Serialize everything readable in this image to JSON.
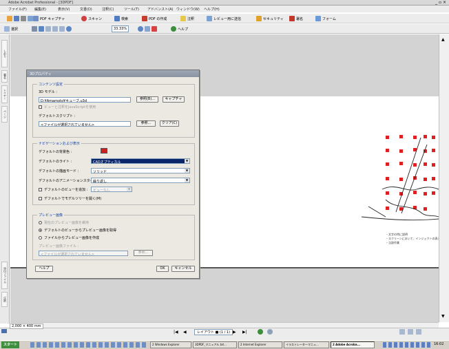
{
  "window": {
    "title": "Adobe Acrobat Professional - [3DPDF]",
    "min": "_",
    "restore": "▫",
    "close": "×"
  },
  "menu": [
    "ファイル(F)",
    "編集(E)",
    "表示(V)",
    "文書(D)",
    "注釈(C)",
    "ツール(T)",
    "アドバンスト(A)",
    "ウィンドウ(W)",
    "ヘルプ(H)"
  ],
  "toolbar1": {
    "create_pdf": "PDF キャプチャ",
    "scan": "スキャン",
    "search": "検索",
    "pdf_create": "PDF の作成",
    "comment": "注釈",
    "review": "レビュー用に送信",
    "security": "セキュリティ",
    "sign": "署名",
    "forms": "フォーム"
  },
  "toolbar2": {
    "select": "選択",
    "zoom": "33.33%",
    "help": "ヘルプ"
  },
  "leftbar_tabs": [
    "しおり",
    "署名",
    "レイヤー",
    "ページ",
    "添付ファイル",
    "注釈"
  ],
  "dialog": {
    "title": "3Dプロパティ",
    "content_group": "コンテンツ設定",
    "model_label": "3D モデル :",
    "model_value": "D:¥Amamoto¥キューブ.u3d",
    "browse_button": "参照(B)...",
    "cancel_small_button": "キャプチャ",
    "embed_check": "ビューと注釈をJavaScriptを使用",
    "script_label": "デフォルトスクリプト :",
    "script_value": "<ファイルが選択されていません>",
    "script_browse": "参照...",
    "clear_button": "クリア(C)",
    "nav_group": "ナビゲーションおよび表示",
    "bg_label": "デフォルトの背景色 :",
    "bg_color": "#cc1f1f",
    "light_label": "デフォルトのライト :",
    "light_value": "CADオプティカル",
    "render_label": "デフォルトの描画モード :",
    "render_value": "ソリッド",
    "anim_label": "デフォルトのアニメーションスタイル :",
    "anim_value": "繰り返し",
    "views_check": "デフォルトのビューを追加 :",
    "views_value": "ビューなし",
    "tree_check": "デフォルトでモデルツリーを開く(M)",
    "preview_group": "プレビュー画像",
    "preview_radio1": "現在のプレビュー画像を維持",
    "preview_radio2": "デフォルトのビューからプレビュー画像を取得",
    "preview_radio3": "ファイルからプレビュー画像を作成",
    "preview_file_label": "プレビュー画像ファイル :",
    "preview_file_value": "<ファイルが選択されていません>",
    "preview_browse": "参照...",
    "help_button": "ヘルプ",
    "ok_button": "OK",
    "cancel_button": "キャンセル"
  },
  "page_note": [
    "・文字の特に説明",
    "・スクリーンにおいて、インジェクトの表示",
    "・当該作業"
  ],
  "status": {
    "size": "2,000 × 400 mm",
    "page": "レイアウト ■ (1 / 1)",
    "prev": "◀",
    "next": "▶"
  },
  "taskbar": {
    "start": "スタート",
    "tasks": [
      "2 Windows Explorer",
      "3DPDF_マニュアル.txt...",
      "2 Internet Explorer",
      "イラストレーターマニュ...",
      "2 Adobe Acroba..."
    ],
    "time": "16:02"
  }
}
